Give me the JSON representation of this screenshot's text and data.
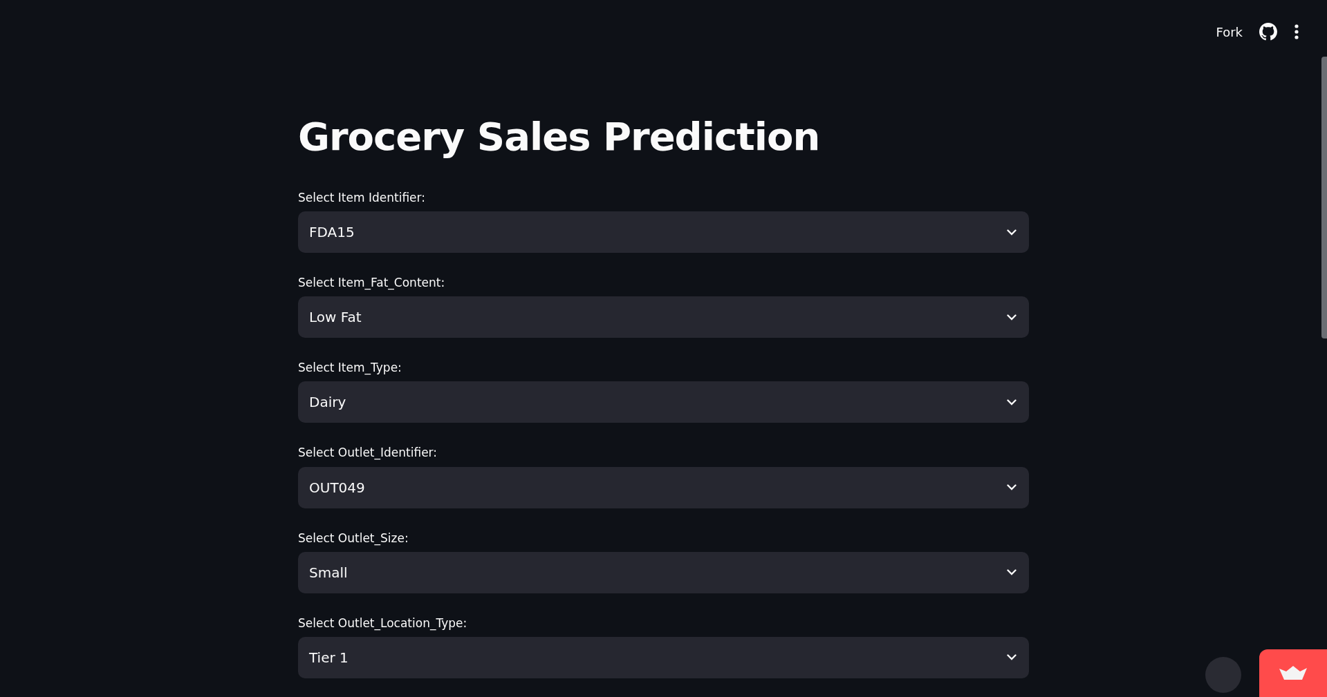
{
  "header": {
    "fork_label": "Fork"
  },
  "title": "Grocery Sales Prediction",
  "selects": [
    {
      "label": "Select Item Identifier:",
      "value": "FDA15"
    },
    {
      "label": "Select Item_Fat_Content:",
      "value": "Low Fat"
    },
    {
      "label": "Select Item_Type:",
      "value": "Dairy"
    },
    {
      "label": "Select Outlet_Identifier:",
      "value": "OUT049"
    },
    {
      "label": "Select Outlet_Size:",
      "value": "Small"
    },
    {
      "label": "Select Outlet_Location_Type:",
      "value": "Tier 1"
    }
  ]
}
